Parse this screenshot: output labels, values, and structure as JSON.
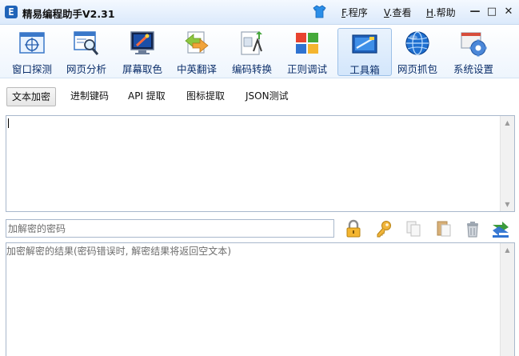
{
  "window": {
    "title": "精易编程助手V2.31",
    "logo_letter": "E",
    "menus": [
      {
        "key": "F",
        "label": ".程序"
      },
      {
        "key": "V",
        "label": ".查看"
      },
      {
        "key": "H",
        "label": ".帮助"
      }
    ],
    "controls": {
      "minimize": "—",
      "maximize": "□",
      "close": "✕"
    }
  },
  "toolbar": {
    "items": [
      {
        "label": "窗口探测",
        "icon": "window-probe-icon"
      },
      {
        "label": "网页分析",
        "icon": "web-analysis-icon"
      },
      {
        "label": "屏幕取色",
        "icon": "color-picker-icon"
      },
      {
        "label": "中英翻译",
        "icon": "translate-icon"
      },
      {
        "label": "编码转换",
        "icon": "encoding-convert-icon"
      },
      {
        "label": "正则调试",
        "icon": "regex-debug-icon"
      },
      {
        "label": "工具箱",
        "icon": "toolbox-icon"
      },
      {
        "label": "网页抓包",
        "icon": "globe-icon"
      },
      {
        "label": "系统设置",
        "icon": "settings-icon"
      }
    ],
    "active_index": 6
  },
  "tabs": [
    "文本加密",
    "进制键码",
    "API 提取",
    "图标提取",
    "JSON测试"
  ],
  "active_tab": 0,
  "input_text": "",
  "password": {
    "placeholder": "加解密的密码",
    "value": ""
  },
  "actions": [
    "lock-icon",
    "key-icon",
    "copy-icon",
    "paste-icon",
    "trash-icon",
    "swap-icon"
  ],
  "result": {
    "placeholder": "加密解密的结果(密码错误时, 解密结果将返回空文本)"
  }
}
